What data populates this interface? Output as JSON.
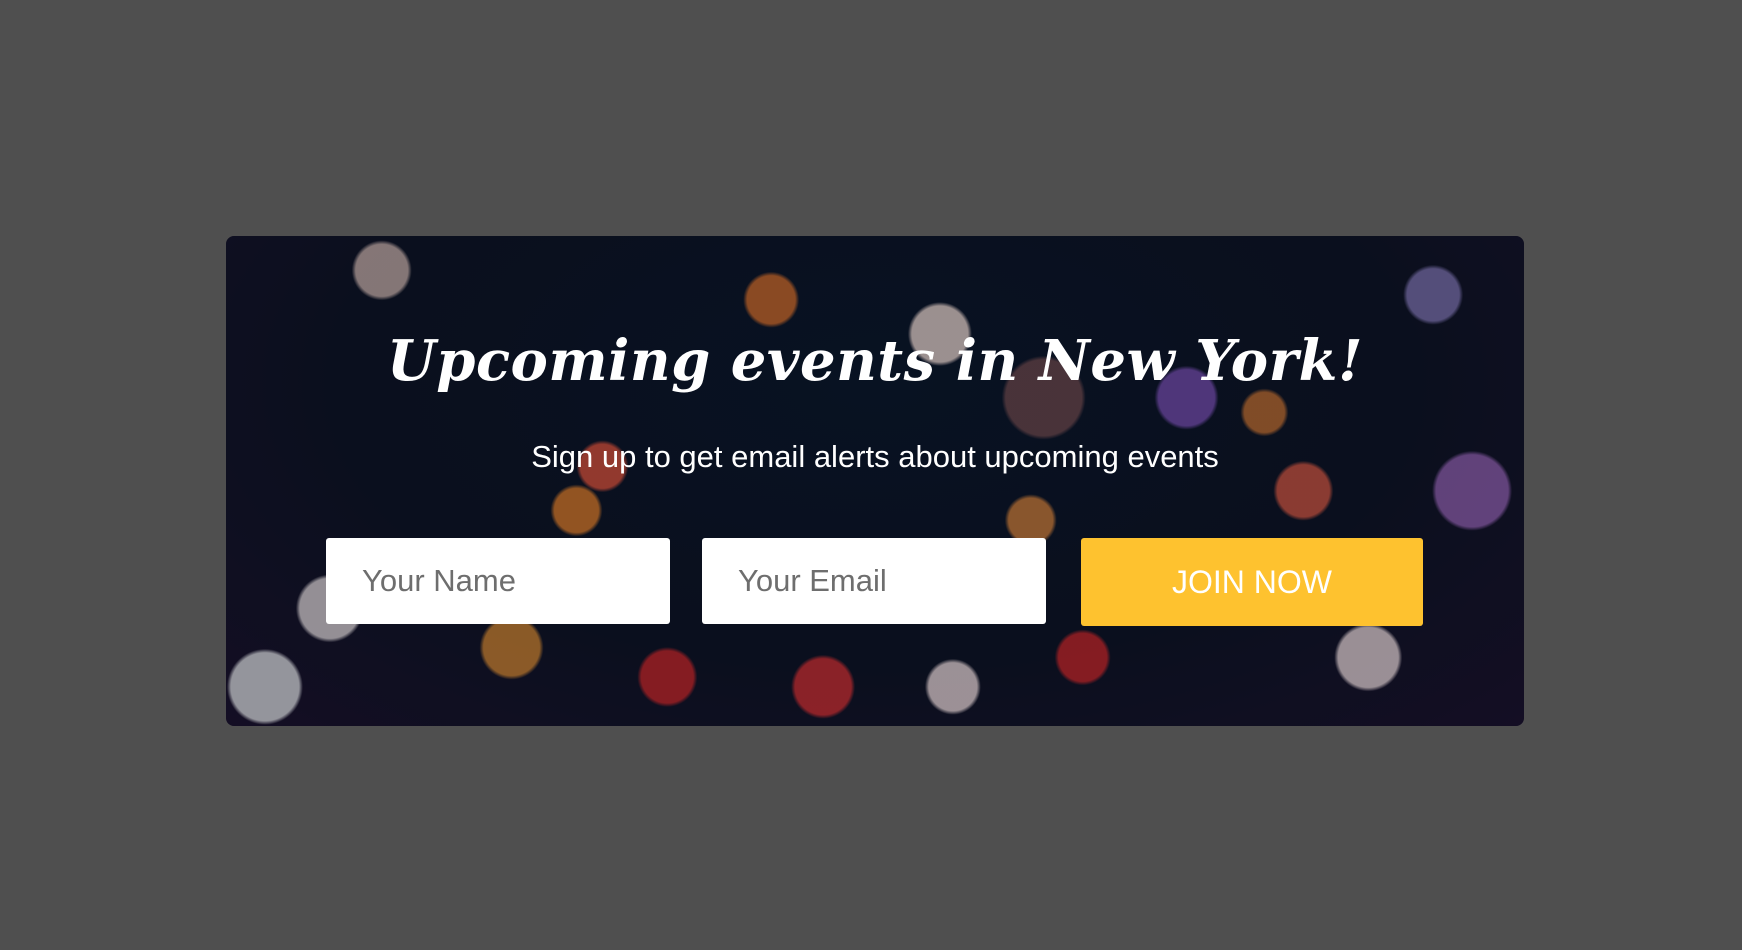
{
  "signup": {
    "title": "Upcoming events in New York!",
    "subtitle": "Sign up to get email alerts about upcoming events",
    "name_placeholder": "Your Name",
    "email_placeholder": "Your Email",
    "join_label": "JOIN NOW"
  },
  "colors": {
    "page_background": "#4f4f4f",
    "button": "#fec22f",
    "text": "#ffffff"
  }
}
